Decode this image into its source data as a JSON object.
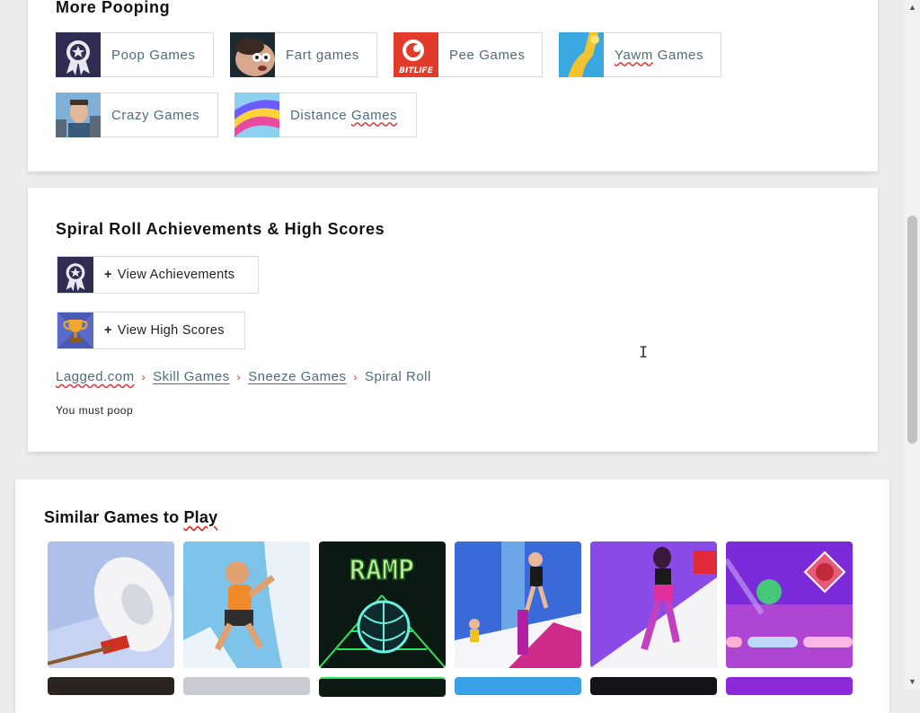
{
  "more_section": {
    "title": "More Pooping",
    "chips": [
      {
        "label": "Poop Games",
        "icon": "award-ribbon-icon"
      },
      {
        "label": "Fart games",
        "icon": "cartoon-face-icon"
      },
      {
        "label": "Pee Games",
        "icon": "bitlife-icon",
        "icon_text": "BITLIFE"
      },
      {
        "label_a": "Yawm",
        "label_b": " Games",
        "icon": "golden-ramp-icon"
      },
      {
        "label": "Crazy Games",
        "icon": "neighbor-character-icon"
      },
      {
        "label_a": "Distance ",
        "label_b": "Games",
        "icon": "colorful-slide-icon"
      }
    ]
  },
  "achievements_section": {
    "title": "Spiral Roll Achievements & High Scores",
    "view_achievements": {
      "plus": "+",
      "label": "View Achievements"
    },
    "view_high_scores": {
      "plus": "+",
      "label": "View High Scores"
    },
    "breadcrumb": {
      "items": [
        "Lagged.com",
        "Skill Games",
        "Sneeze Games"
      ],
      "separator": "›",
      "current": "Spiral Roll"
    },
    "description": "You must poop"
  },
  "similar_section": {
    "title_a": "Similar Games to ",
    "title_b": "Play",
    "games": [
      {
        "name": "spiral-roll-thumbnail"
      },
      {
        "name": "climber-thumbnail"
      },
      {
        "name": "ramp-thumbnail",
        "text": "RAMP"
      },
      {
        "name": "stilt-runner-thumbnail"
      },
      {
        "name": "runner-girl-thumbnail"
      },
      {
        "name": "ball-jump-thumbnail"
      }
    ]
  },
  "scrollbar": {
    "up_arrow": "▲",
    "down_arrow": "▼"
  },
  "cursor_glyph": "I"
}
